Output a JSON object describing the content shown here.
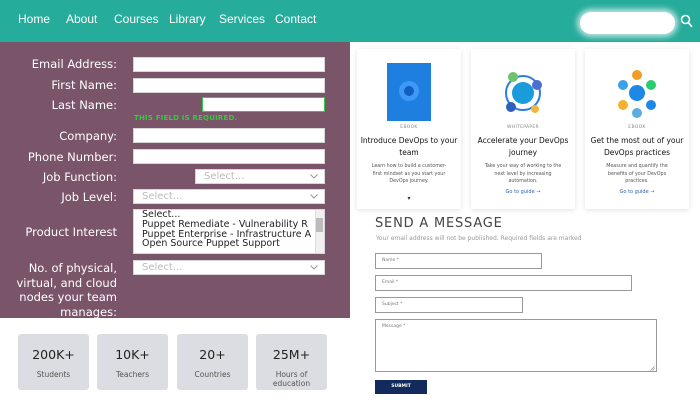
{
  "nav": {
    "items": [
      "Home",
      "About",
      "Courses",
      "Library",
      "Services",
      "Contact"
    ],
    "search_placeholder": ""
  },
  "form": {
    "email_label": "Email Address:",
    "first_name_label": "First Name:",
    "last_name_label": "Last Name:",
    "error": "THIS FIELD IS REQUIRED.",
    "company_label": "Company:",
    "phone_label": "Phone Number:",
    "job_function_label": "Job Function:",
    "job_function_value": "Select...",
    "job_level_label": "Job Level:",
    "job_level_value": "Select...",
    "product_interest_label": "Product Interest",
    "product_interest_options": [
      "Select...",
      "Puppet Remediate - Vulnerability R",
      "Puppet Enterprise - Infrastructure A",
      "Open Source Puppet Support"
    ],
    "nodes_label": [
      "No. of physical,",
      "virtual, and cloud",
      "nodes your team",
      "manages:"
    ],
    "nodes_value": "Select..."
  },
  "stats": [
    {
      "value": "200K+",
      "label": "Students"
    },
    {
      "value": "10K+",
      "label": "Teachers"
    },
    {
      "value": "20+",
      "label": "Countries"
    },
    {
      "value": "25M+",
      "label": "Hours of education"
    }
  ],
  "cards": [
    {
      "tag": "EBOOK",
      "title": "Introduce DevOps to your team",
      "desc": "Learn how to build a customer-first mindset as you start your DevOps journey.",
      "link": ""
    },
    {
      "tag": "WHITEPAPER",
      "title": "Accelerate your DevOps journey",
      "desc": "Take your way of working to the next level by increasing automation.",
      "link": "Go to guide →"
    },
    {
      "tag": "EBOOK",
      "title": "Get the most out of your DevOps practices",
      "desc": "Measure and quantify the benefits of your DevOps practices.",
      "link": "Go to guide →"
    }
  ],
  "message": {
    "title": "SEND A MESSAGE",
    "subtitle": "Your email address will not be published. Required fields are marked",
    "name_placeholder": "Name *",
    "email_placeholder": "Email *",
    "subject_placeholder": "Subject *",
    "message_placeholder": "Message *",
    "submit_label": "SUBMIT"
  },
  "colors": {
    "nav": "#26ac9b",
    "form_bg": "#7a5468",
    "error": "#2ecc40",
    "stat_bg": "#dcdde2",
    "submit_bg": "#122a5c"
  }
}
